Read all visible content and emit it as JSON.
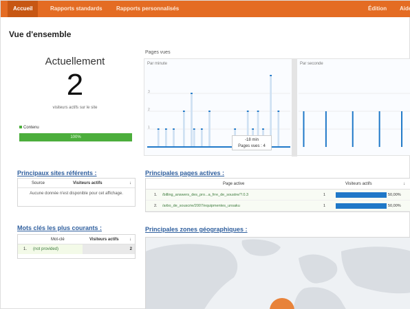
{
  "nav": {
    "tabs": [
      {
        "label": "Accueil"
      },
      {
        "label": "Rapports standards"
      },
      {
        "label": "Rapports personnalisés"
      },
      {
        "label": "Édition"
      },
      {
        "label": "Aide"
      }
    ]
  },
  "page": {
    "title": "Vue d'ensemble"
  },
  "summary": {
    "label": "Actuellement",
    "value": "2",
    "sublabel": "visiteurs actifs sur le site",
    "legend": "Contenu",
    "bar_text": "100%"
  },
  "referrers": {
    "title": "Principaux sites référents :",
    "col_source": "Source",
    "col_visitors": "Visiteurs actifs",
    "empty_message": "Aucune donnée n'est disponible pour cet affichage."
  },
  "keywords": {
    "title": "Mots clés les plus courants :",
    "col_keyword": "Mot-clé",
    "col_visitors": "Visiteurs actifs",
    "rows": [
      {
        "index": "1.",
        "keyword": "(not provided)",
        "count": "2"
      }
    ]
  },
  "pageviews_chart": {
    "title": "Pages vues",
    "left_pane_label": "Par minute",
    "right_pane_label": "Par seconde",
    "tooltip_line1": "-18 min",
    "tooltip_line2": "Pages vues : 4"
  },
  "chart_data": {
    "type": "bar",
    "title": "Pages vues",
    "panes": [
      {
        "name": "Par minute",
        "ylim": [
          0,
          4
        ],
        "yticks": [
          1,
          2,
          3
        ],
        "values": [
          0,
          0,
          0,
          0,
          1,
          0,
          0,
          1,
          0,
          0,
          1,
          0,
          0,
          0,
          2,
          0,
          0,
          3,
          1,
          0,
          0,
          1,
          0,
          0,
          2,
          0,
          0,
          0,
          0,
          0,
          0,
          0,
          0,
          0,
          1,
          0,
          0,
          0,
          0,
          2,
          0,
          1,
          0,
          2,
          0,
          1,
          0,
          0,
          4,
          0,
          0,
          2,
          0,
          0,
          0,
          0
        ]
      },
      {
        "name": "Par seconde",
        "ylim": [
          0,
          4
        ],
        "values": [
          0,
          0,
          2,
          0,
          0,
          0,
          0,
          0,
          0,
          0,
          0,
          0,
          2,
          0,
          0,
          0,
          0,
          0,
          0,
          0,
          0,
          0,
          0,
          0,
          2,
          0,
          0,
          0,
          0,
          0,
          0,
          0,
          0,
          0,
          0,
          0,
          2,
          0,
          0,
          0,
          0,
          0,
          0,
          0,
          0,
          0,
          2,
          0,
          0,
          0
        ]
      }
    ]
  },
  "active_pages": {
    "title": "Principales pages actives :",
    "col_page": "Page active",
    "col_visitors": "Visiteurs actifs",
    "rows": [
      {
        "index": "1.",
        "url": "/billing_answers_des_pro...a_frre_de_soustre/?.0.3",
        "count": "1",
        "pct": "50,00%",
        "fraction": 0.5
      },
      {
        "index": "2.",
        "url": "/arbo_de_souscrie/2007/equipmentes_unsaku",
        "count": "1",
        "pct": "50,00%",
        "fraction": 0.5
      }
    ]
  },
  "geo": {
    "title": "Principales zones géographiques :"
  },
  "colors": {
    "nav": "#e46c23",
    "bar_blue": "#1f78c8",
    "bar_light": "#cfe1f3",
    "green": "#4cae3c",
    "marker": "#e8833a"
  }
}
